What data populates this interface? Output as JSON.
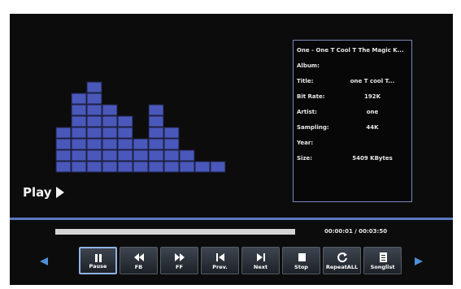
{
  "player": {
    "state_label": "Play",
    "colors": {
      "bars": "#4a58bb",
      "divider": "#5c79c6",
      "active_border": "#8fb3e6",
      "nav_arrow": "#4d8fd6"
    }
  },
  "spectrum": {
    "levels": [
      4,
      7,
      8,
      6,
      5,
      3,
      6,
      4,
      2,
      1,
      1
    ]
  },
  "info_panel": {
    "header": "One - One T Cool T The Magic K...",
    "rows": [
      {
        "label": "Album:",
        "value": ""
      },
      {
        "label": "Title:",
        "value": "one T cool T..."
      },
      {
        "label": "Bit Rate:",
        "value": "192K"
      },
      {
        "label": "Artist:",
        "value": "one"
      },
      {
        "label": "Sampling:",
        "value": "44K"
      },
      {
        "label": "Year:",
        "value": ""
      },
      {
        "label": "Size:",
        "value": "5409 KBytes"
      }
    ]
  },
  "progress": {
    "elapsed": "00:00:01",
    "separator": "/",
    "total": "00:03:50",
    "display": "00:00:01 / 00:03:50"
  },
  "controls": {
    "buttons": [
      {
        "label": "Pause",
        "icon": "pause-icon",
        "active": true
      },
      {
        "label": "FB",
        "icon": "fast-backward-icon"
      },
      {
        "label": "FF",
        "icon": "fast-forward-icon"
      },
      {
        "label": "Prev.",
        "icon": "previous-icon"
      },
      {
        "label": "Next",
        "icon": "next-icon"
      },
      {
        "label": "Stop",
        "icon": "stop-icon"
      },
      {
        "label": "RepeatALL",
        "icon": "repeat-icon"
      },
      {
        "label": "Songlist",
        "icon": "songlist-icon"
      }
    ],
    "left_arrow_icon": "left-arrow-icon",
    "right_arrow_icon": "right-arrow-icon"
  }
}
